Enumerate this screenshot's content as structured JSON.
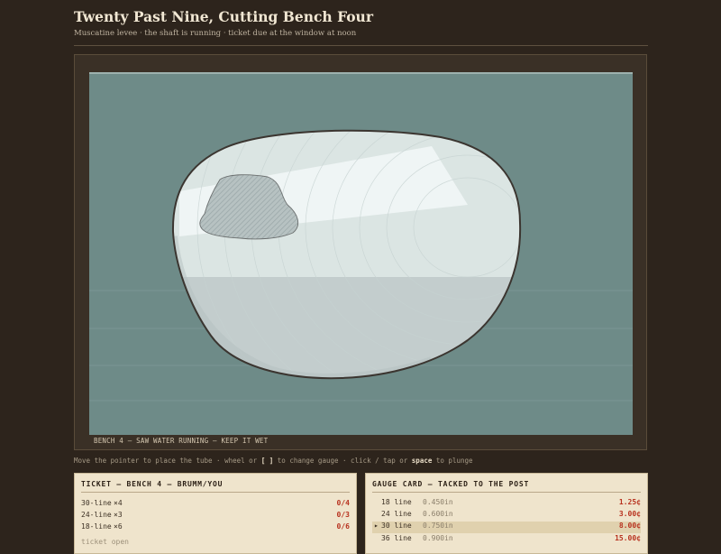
{
  "header": {
    "title": "Twenty Past Nine, Cutting Bench Four",
    "subtitle": "Muscatine levee · the shaft is running · ticket due at the window at noon"
  },
  "scene": {
    "caption": "BENCH 4 — SAW WATER RUNNING — KEEP IT WET"
  },
  "help": {
    "part1": "Move the pointer to place the tube · wheel or ",
    "key1": "[ ]",
    "part2": " to change gauge · click / tap or ",
    "key2": "space",
    "part3": " to plunge"
  },
  "ticket": {
    "title": "TICKET — BENCH 4 — BRUMM/YOU",
    "rows": [
      {
        "gauge": "30-line",
        "qty": "×4",
        "progress": "0/4"
      },
      {
        "gauge": "24-line",
        "qty": "×3",
        "progress": "0/3"
      },
      {
        "gauge": "18-line",
        "qty": "×6",
        "progress": "0/6"
      }
    ],
    "footer": "ticket open"
  },
  "gauge_card": {
    "title": "GAUGE CARD — TACKED TO THE POST",
    "rows": [
      {
        "marker": "",
        "line": "18 line",
        "size": "0.450in",
        "price": "1.25¢",
        "selected": false
      },
      {
        "marker": "",
        "line": "24 line",
        "size": "0.600in",
        "price": "3.00¢",
        "selected": false
      },
      {
        "marker": "▸",
        "line": "30 line",
        "size": "0.750in",
        "price": "8.00¢",
        "selected": true
      },
      {
        "marker": "",
        "line": "36 line",
        "size": "0.900in",
        "price": "15.00¢",
        "selected": false
      }
    ]
  },
  "colors": {
    "background": "#2d241c",
    "water": "#6e8b88",
    "shell": "#d9e4e2",
    "price_red": "#b8321f",
    "card": "#efe4cc"
  }
}
